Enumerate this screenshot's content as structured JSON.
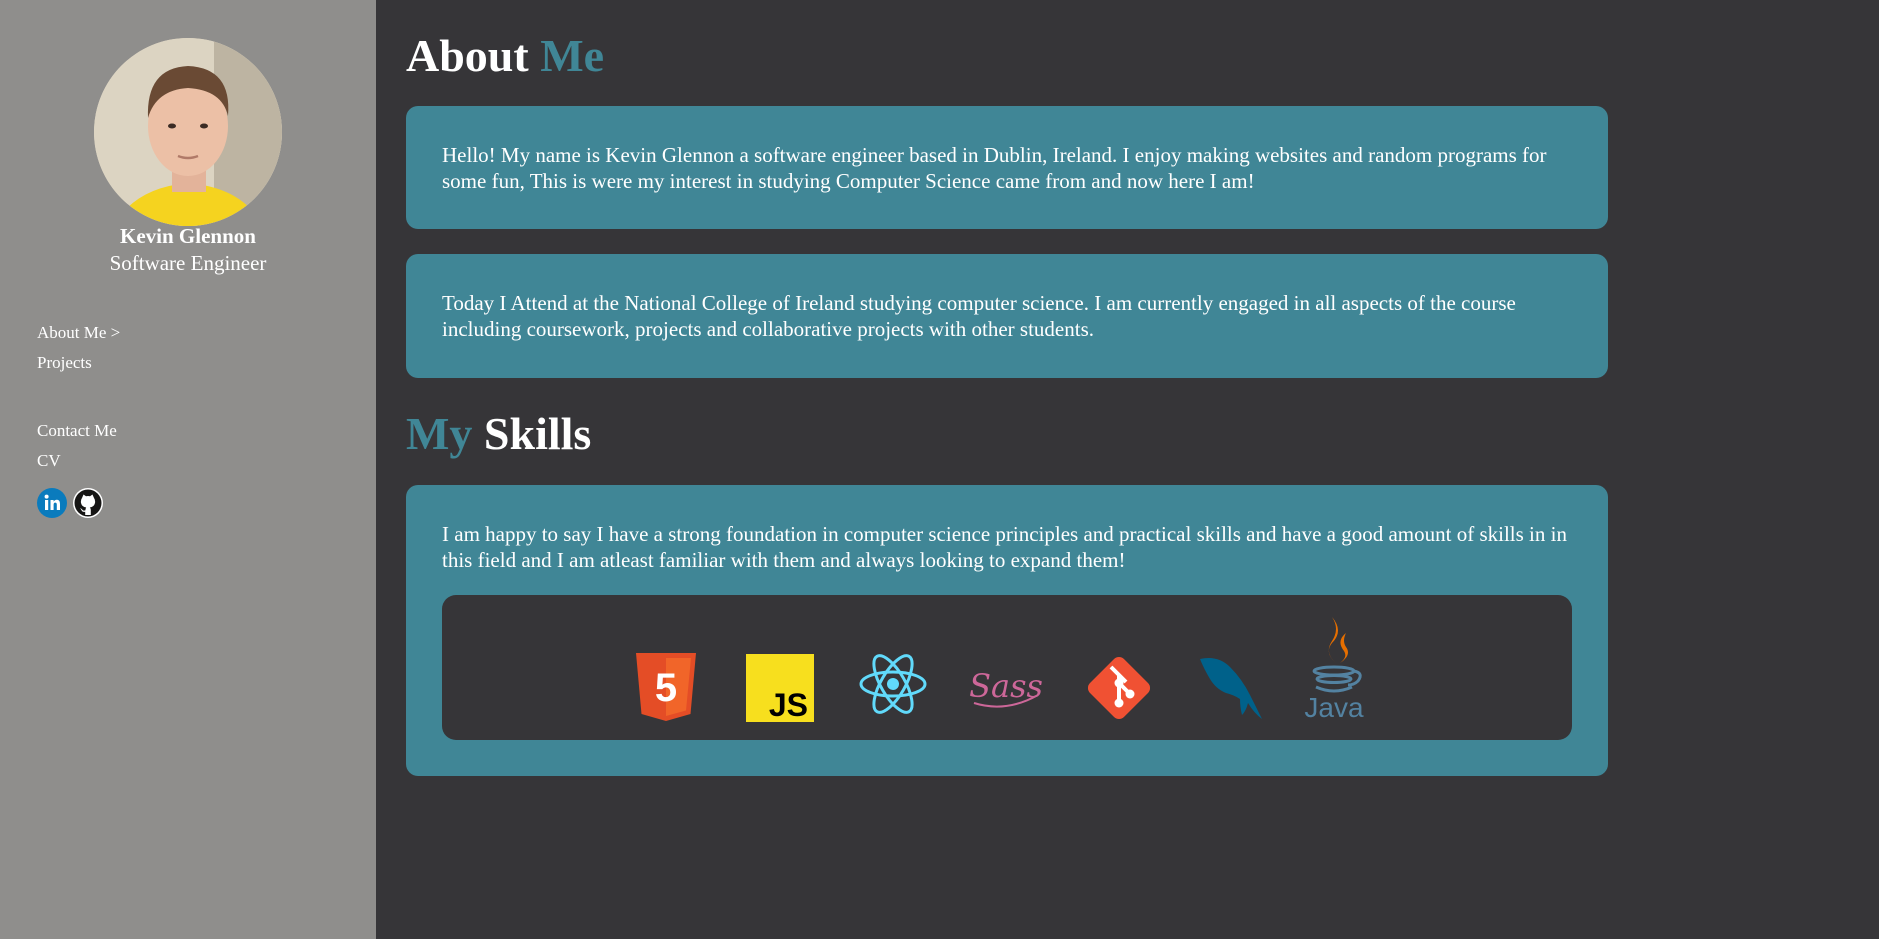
{
  "sidebar": {
    "name": "Kevin Glennon",
    "role": "Software Engineer",
    "nav": {
      "about": "About Me >",
      "projects": "Projects",
      "contact": "Contact Me",
      "cv": "CV"
    },
    "socials": [
      "linkedin-icon",
      "github-icon"
    ]
  },
  "about": {
    "heading_white": "About",
    "heading_accent": "Me",
    "paragraph1": "Hello! My name is Kevin Glennon a software engineer based in Dublin, Ireland. I enjoy making websites and random programs for some fun, This is were my interest in studying Computer Science came from and now here I am!",
    "paragraph2": "Today I Attend at the National College of Ireland studying computer science. I am currently engaged in all aspects of the course including coursework, projects and collaborative projects with other students."
  },
  "skills": {
    "heading_accent": "My",
    "heading_white": "Skills",
    "paragraph": "I am happy to say I have a strong foundation in computer science principles and practical skills and have a good amount of skills in in this field and I am atleast familiar with them and always looking to expand them!",
    "icons": [
      "html5-icon",
      "javascript-icon",
      "react-icon",
      "sass-icon",
      "git-icon",
      "mysql-icon",
      "java-icon"
    ],
    "icon_texts": {
      "html5": "5",
      "javascript": "JS",
      "sass": "Sass",
      "java": "Java"
    }
  },
  "colors": {
    "accent": "#408696",
    "background": "#363538",
    "sidebar": "#8f8e8c"
  }
}
